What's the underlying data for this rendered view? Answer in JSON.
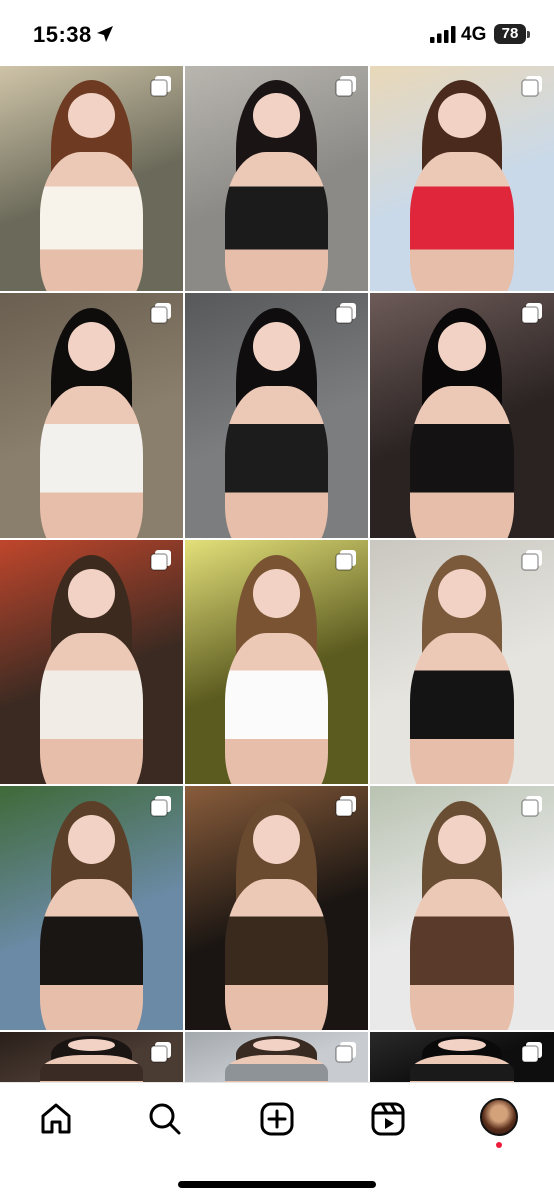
{
  "status_bar": {
    "time": "15:38",
    "network": "4G",
    "battery": "78",
    "icons": [
      "location-arrow-icon",
      "signal-bars-icon",
      "battery-icon"
    ]
  },
  "grid": {
    "tiles": [
      {
        "name": "post-1",
        "colors": {
          "bg": "#6b6a5a",
          "accent": "#cfc4a8",
          "hair": "#6e3a22",
          "top": "#f7f2ea"
        }
      },
      {
        "name": "post-2",
        "colors": {
          "bg": "#8c8a86",
          "accent": "#b9b6b0",
          "hair": "#1a1414",
          "top": "#1b1b1b"
        }
      },
      {
        "name": "post-3",
        "colors": {
          "bg": "#c9d9ea",
          "accent": "#e9d8b8",
          "hair": "#4a2a1c",
          "top": "#e0263a"
        }
      },
      {
        "name": "post-4",
        "colors": {
          "bg": "#8a7f6c",
          "accent": "#6a5f50",
          "hair": "#0f0c0c",
          "top": "#f3f1ee"
        }
      },
      {
        "name": "post-5",
        "colors": {
          "bg": "#7c7d7f",
          "accent": "#56585a",
          "hair": "#0f0d0d",
          "top": "#1c1c1c"
        }
      },
      {
        "name": "post-6",
        "colors": {
          "bg": "#2a2322",
          "accent": "#6d5b58",
          "hair": "#0a0808",
          "top": "#141212"
        }
      },
      {
        "name": "post-7",
        "colors": {
          "bg": "#3a2a22",
          "accent": "#c0462c",
          "hair": "#3c2a1e",
          "top": "#f1ede6"
        }
      },
      {
        "name": "post-8",
        "colors": {
          "bg": "#5b5a1f",
          "accent": "#e3e07a",
          "hair": "#7a5432",
          "top": "#fbfbfb"
        }
      },
      {
        "name": "post-9",
        "colors": {
          "bg": "#e5e4df",
          "accent": "#c9c7bf",
          "hair": "#7b5a3c",
          "top": "#141414"
        }
      },
      {
        "name": "post-10",
        "colors": {
          "bg": "#6b8aa6",
          "accent": "#3f6a38",
          "hair": "#5b3f28",
          "top": "#1a1614"
        }
      },
      {
        "name": "post-11",
        "colors": {
          "bg": "#1a1512",
          "accent": "#8a5d3b",
          "hair": "#6b4b2f",
          "top": "#3a2a1e"
        }
      },
      {
        "name": "post-12",
        "colors": {
          "bg": "#e9e9ea",
          "accent": "#b9c3b1",
          "hair": "#6a4e34",
          "top": "#5a3a2a"
        }
      },
      {
        "name": "post-13",
        "colors": {
          "bg": "#4a3b33",
          "accent": "#2a1f1a",
          "hair": "#1a1412",
          "top": "#3a2b24"
        }
      },
      {
        "name": "post-14",
        "colors": {
          "bg": "#c8ccd0",
          "accent": "#a3a8ad",
          "hair": "#3a2b22",
          "top": "#8e9398"
        }
      },
      {
        "name": "post-15",
        "colors": {
          "bg": "#0e0e0e",
          "accent": "#2a2a2a",
          "hair": "#0a0a0a",
          "top": "#1a1a1a"
        }
      }
    ],
    "overlay_icon": "multiple-photos-icon"
  },
  "bottom_nav": {
    "items": [
      "home-icon",
      "search-icon",
      "create-post-icon",
      "reels-icon",
      "profile-avatar"
    ],
    "notification_color": "#ed1c3a"
  }
}
